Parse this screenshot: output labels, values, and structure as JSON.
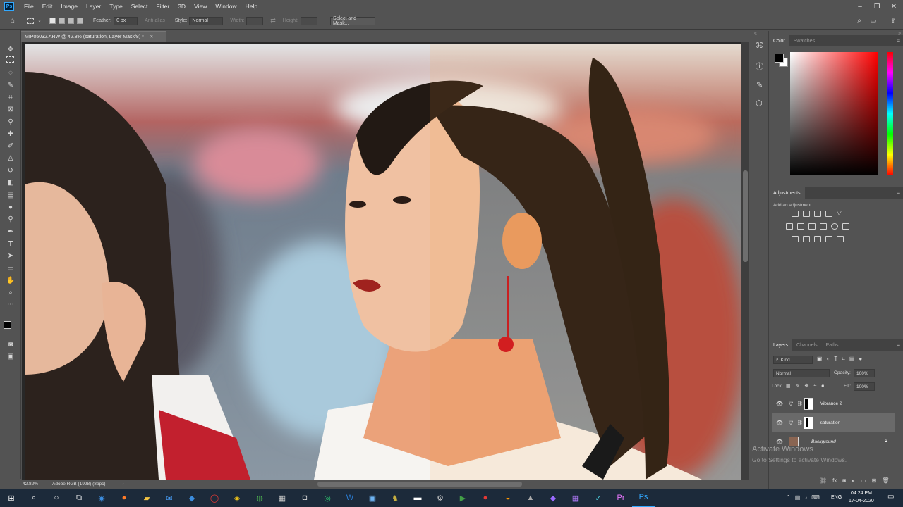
{
  "app": {
    "logo": "Ps"
  },
  "menu": [
    "File",
    "Edit",
    "Image",
    "Layer",
    "Type",
    "Select",
    "Filter",
    "3D",
    "View",
    "Window",
    "Help"
  ],
  "options": {
    "feather_label": "Feather:",
    "feather_value": "0 px",
    "antialias": "Anti-alias",
    "style_label": "Style:",
    "style_value": "Normal",
    "width_label": "Width:",
    "height_label": "Height:",
    "select_mask": "Select and Mask..."
  },
  "document": {
    "tab_title": "MIP05032.ARW @ 42.8% (saturation, Layer Mask/8) *"
  },
  "status": {
    "zoom": "42.82%",
    "profile": "Adobe RGB (1998) (8bpc)"
  },
  "color_panel": {
    "tabs": [
      "Color",
      "Swatches"
    ]
  },
  "adjustments": {
    "title": "Adjustments",
    "hint": "Add an adjustment"
  },
  "layers_panel": {
    "tabs": [
      "Layers",
      "Channels",
      "Paths"
    ],
    "filter": "Kind",
    "blend_mode": "Normal",
    "opacity_label": "Opacity:",
    "opacity": "100%",
    "lock_label": "Lock:",
    "fill_label": "Fill:",
    "fill": "100%",
    "layers": [
      {
        "name": "Vibrance 2"
      },
      {
        "name": "saturation"
      },
      {
        "name": "Background"
      }
    ]
  },
  "watermark": {
    "line1": "Activate Windows",
    "line2": "Go to Settings to activate Windows."
  },
  "taskbar": {
    "time": "04:24 PM",
    "date": "17-04-2020",
    "lang": "ENG"
  },
  "colors": {
    "ui_bg": "#535353",
    "canvas_bg": "#282828",
    "accent": "#31a8ff",
    "taskbar": "#1c2a3a"
  }
}
